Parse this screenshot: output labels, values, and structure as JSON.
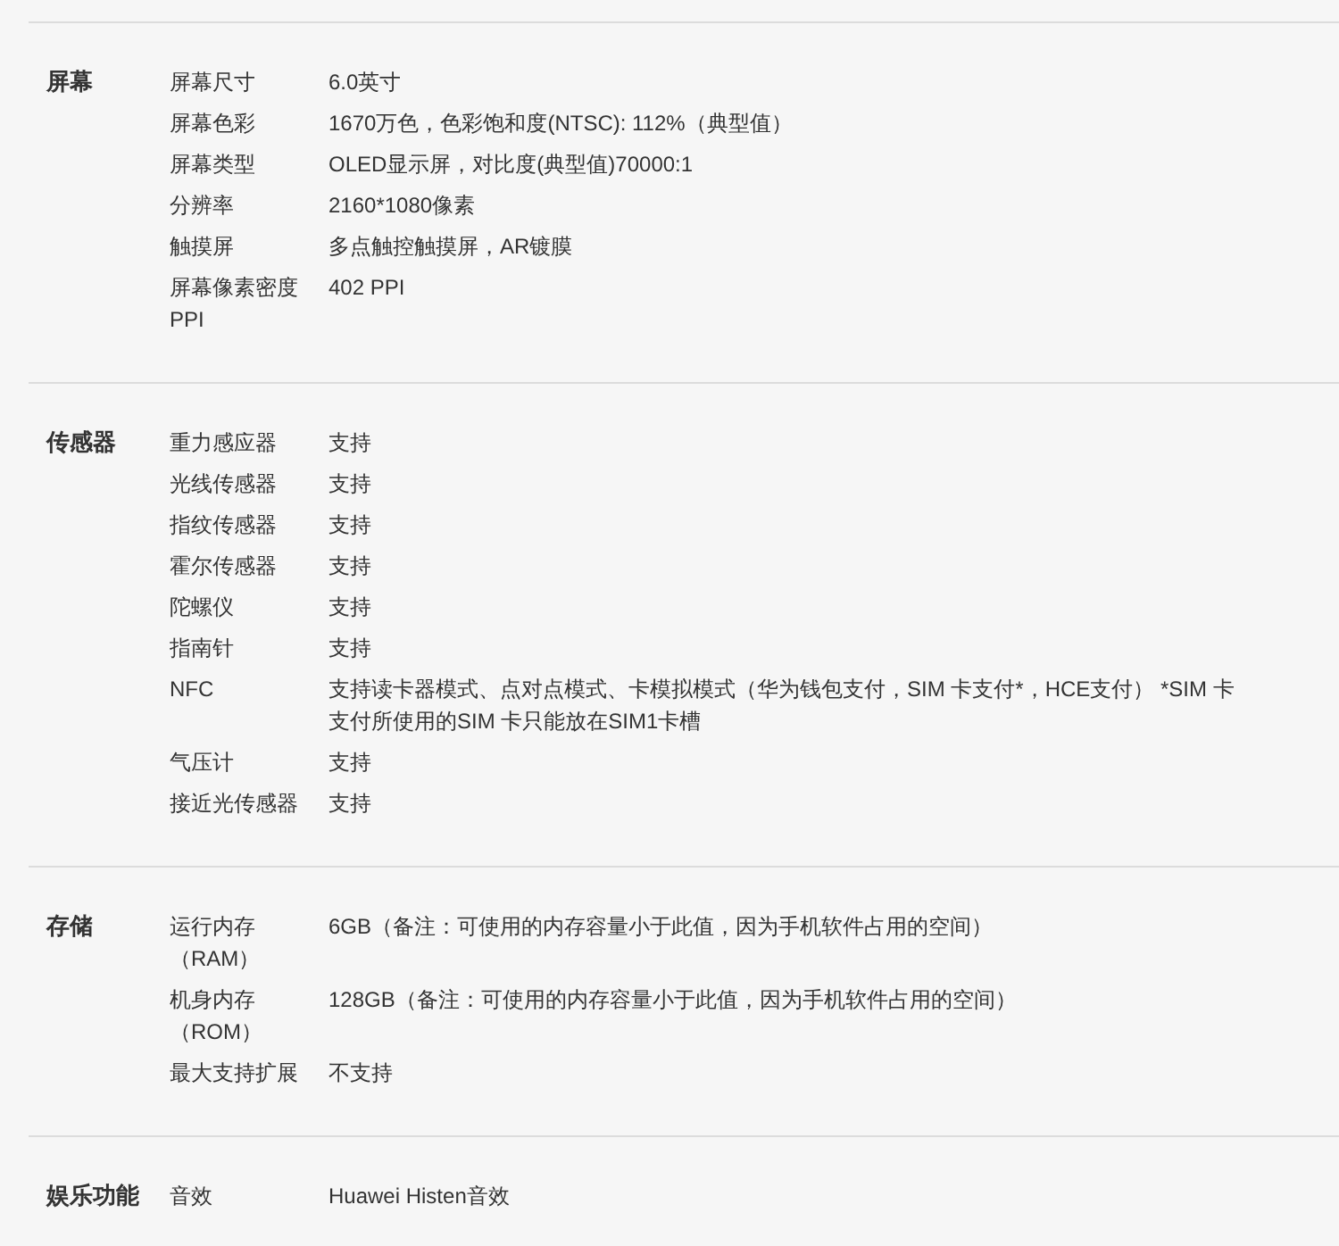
{
  "sections": [
    {
      "title": "屏幕",
      "rows": [
        {
          "label": "屏幕尺寸",
          "value": "6.0英寸"
        },
        {
          "label": "屏幕色彩",
          "value": "1670万色，色彩饱和度(NTSC): 112%（典型值）"
        },
        {
          "label": "屏幕类型",
          "value": "OLED显示屏，对比度(典型值)70000:1"
        },
        {
          "label": "分辨率",
          "value": "2160*1080像素"
        },
        {
          "label": "触摸屏",
          "value": "多点触控触摸屏，AR镀膜"
        },
        {
          "label": "屏幕像素密度 PPI",
          "value": "402 PPI"
        }
      ]
    },
    {
      "title": "传感器",
      "rows": [
        {
          "label": "重力感应器",
          "value": "支持"
        },
        {
          "label": "光线传感器",
          "value": "支持"
        },
        {
          "label": "指纹传感器",
          "value": "支持"
        },
        {
          "label": "霍尔传感器",
          "value": "支持"
        },
        {
          "label": "陀螺仪",
          "value": "支持"
        },
        {
          "label": "指南针",
          "value": "支持"
        },
        {
          "label": "NFC",
          "value": "支持读卡器模式、点对点模式、卡模拟模式（华为钱包支付，SIM 卡支付*，HCE支付） *SIM 卡支付所使用的SIM 卡只能放在SIM1卡槽"
        },
        {
          "label": "气压计",
          "value": "支持"
        },
        {
          "label": "接近光传感器",
          "value": "支持"
        }
      ]
    },
    {
      "title": "存储",
      "rows": [
        {
          "label": "运行内存（RAM）",
          "value": "6GB（备注：可使用的内存容量小于此值，因为手机软件占用的空间）"
        },
        {
          "label": "机身内存（ROM）",
          "value": "128GB（备注：可使用的内存容量小于此值，因为手机软件占用的空间）"
        },
        {
          "label": "最大支持扩展",
          "value": "不支持"
        }
      ]
    },
    {
      "title": "娱乐功能",
      "rows": [
        {
          "label": "音效",
          "value": "Huawei Histen音效"
        }
      ]
    }
  ]
}
